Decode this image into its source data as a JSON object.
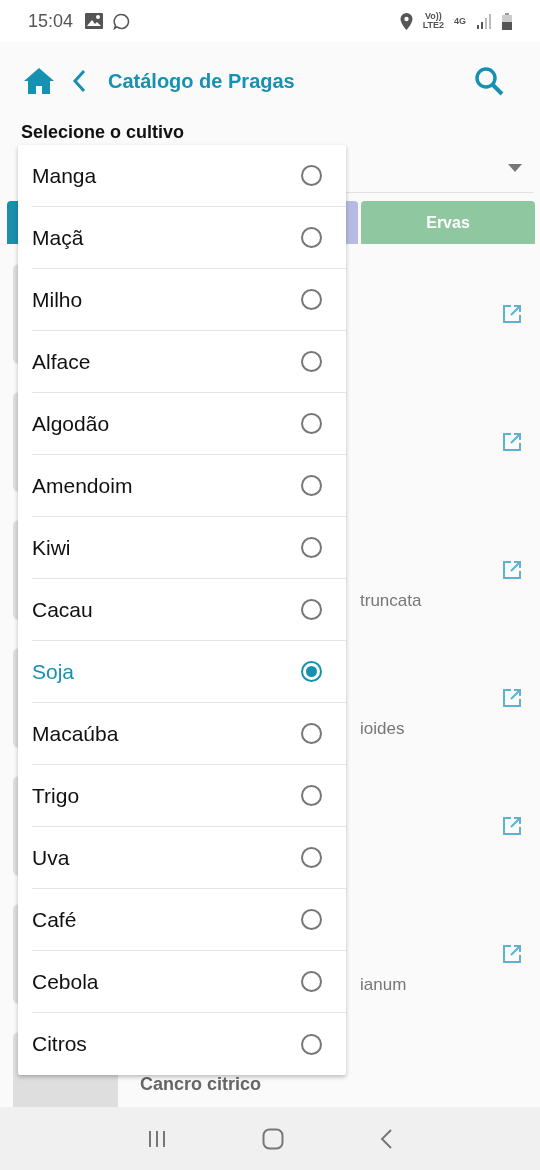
{
  "status_bar": {
    "time": "15:04",
    "volte": "Vo))",
    "lte": "LTE2",
    "network": "4G"
  },
  "header": {
    "title": "Catálogo de Pragas"
  },
  "crop_select": {
    "label": "Selecione o cultivo"
  },
  "tabs": [
    {
      "color": "#1b8fae"
    },
    {
      "color": "#b7bbe4"
    },
    {
      "label": "Ervas",
      "color": "#8fc7a0"
    }
  ],
  "pests": [
    {
      "external_link": true
    },
    {
      "external_link": true
    },
    {
      "subtitle": "truncata",
      "external_link": true
    },
    {
      "subtitle": "ioides",
      "external_link": true
    },
    {
      "external_link": true
    },
    {
      "subtitle": "ianum",
      "external_link": true
    },
    {
      "title": "Cancro citrico",
      "external_link": false
    }
  ],
  "dropdown": {
    "options": [
      {
        "label": "Manga",
        "selected": false
      },
      {
        "label": "Maçã",
        "selected": false
      },
      {
        "label": "Milho",
        "selected": false
      },
      {
        "label": "Alface",
        "selected": false
      },
      {
        "label": "Algodão",
        "selected": false
      },
      {
        "label": "Amendoim",
        "selected": false
      },
      {
        "label": "Kiwi",
        "selected": false
      },
      {
        "label": "Cacau",
        "selected": false
      },
      {
        "label": "Soja",
        "selected": true
      },
      {
        "label": "Macaúba",
        "selected": false
      },
      {
        "label": "Trigo",
        "selected": false
      },
      {
        "label": "Uva",
        "selected": false
      },
      {
        "label": "Café",
        "selected": false
      },
      {
        "label": "Cebola",
        "selected": false
      },
      {
        "label": "Citros",
        "selected": false
      }
    ]
  }
}
